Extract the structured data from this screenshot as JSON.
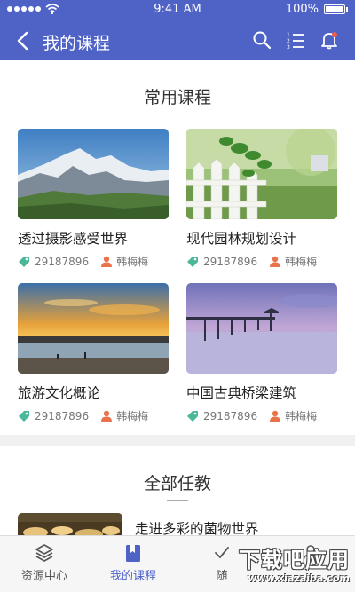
{
  "status_bar": {
    "time": "9:41 AM",
    "battery": "100%"
  },
  "header": {
    "title": "我的课程",
    "icons": [
      "back-icon",
      "search-icon",
      "list-icon",
      "bell-icon"
    ],
    "color": "#4f63c7"
  },
  "common_courses": {
    "title": "常用课程",
    "items": [
      {
        "title": "透过摄影感受世界",
        "count": "29187896",
        "author": "韩梅梅",
        "image": "snow-mountain"
      },
      {
        "title": "现代园林规划设计",
        "count": "29187896",
        "author": "韩梅梅",
        "image": "garden-fence"
      },
      {
        "title": "旅游文化概论",
        "count": "29187896",
        "author": "韩梅梅",
        "image": "sunset-beach"
      },
      {
        "title": "中国古典桥梁建筑",
        "count": "29187896",
        "author": "韩梅梅",
        "image": "pier-dusk"
      }
    ]
  },
  "all_courses": {
    "title": "全部任教",
    "items": [
      {
        "title": "走进多彩的菌物世界",
        "image": "mushrooms"
      }
    ]
  },
  "tabbar": {
    "items": [
      {
        "label": "资源中心",
        "icon": "layers-icon",
        "active": false
      },
      {
        "label": "我的课程",
        "icon": "book-icon",
        "active": true
      },
      {
        "label": "随",
        "icon": "check-icon",
        "active": false
      },
      {
        "label": "",
        "icon": "profile-icon",
        "active": false
      }
    ]
  },
  "watermark": {
    "main": "下载吧应用",
    "url": "www.xiazaiba.com"
  },
  "colors": {
    "accent": "#4f63c7",
    "tag": "#4cb89a",
    "user": "#e8734a"
  }
}
